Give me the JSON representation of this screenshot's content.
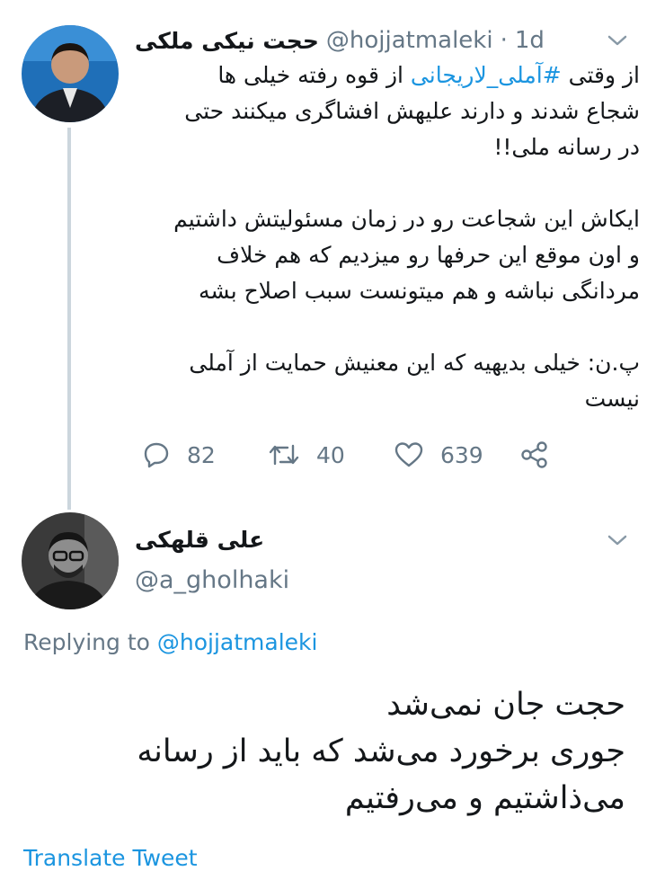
{
  "tweet1": {
    "display_name": "حجت نیکی ملکی",
    "handle": "@hojjatmaleki",
    "separator": "·",
    "time": "1d",
    "lines": [
      {
        "pre": "از وقتی ",
        "hashtag": "#آملی_لاریجانی",
        "post": " از قوه رفته خیلی ها"
      },
      {
        "text": "شجاع شدند و دارند علیهش افشاگری میکنند حتی"
      },
      {
        "text": "در رسانه ملی!!"
      },
      {
        "text": ""
      },
      {
        "text": "ایکاش این شجاعت رو در زمان مسئولیتش داشتیم"
      },
      {
        "text": "و اون موقع این حرفها رو میزدیم که هم خلاف"
      },
      {
        "text": "مردانگی نباشه و هم میتونست سبب اصلاح بشه"
      },
      {
        "text": ""
      },
      {
        "text": "پ.ن: خیلی بدیهیه که این معنیش حمایت از آملی"
      },
      {
        "text": "نیست"
      }
    ],
    "actions": {
      "reply_icon": "reply-icon",
      "reply_count": "82",
      "retweet_icon": "retweet-icon",
      "retweet_count": "40",
      "like_icon": "heart-icon",
      "like_count": "639",
      "share_icon": "share-icon"
    }
  },
  "tweet2": {
    "display_name": "علی قلهکی",
    "handle": "@a_gholhaki",
    "replying_label": "Replying to ",
    "replying_to": "@hojjatmaleki",
    "lines": [
      "حجت جان نمی‌شد",
      "جوری برخورد می‌شد که باید از رسانه",
      "می‌ذاشتیم و می‌رفتیم"
    ],
    "translate_label": "Translate Tweet"
  },
  "colors": {
    "text": "#14171a",
    "secondary": "#657786",
    "accent": "#1b95e0",
    "thread_line": "#ccd6dd"
  }
}
